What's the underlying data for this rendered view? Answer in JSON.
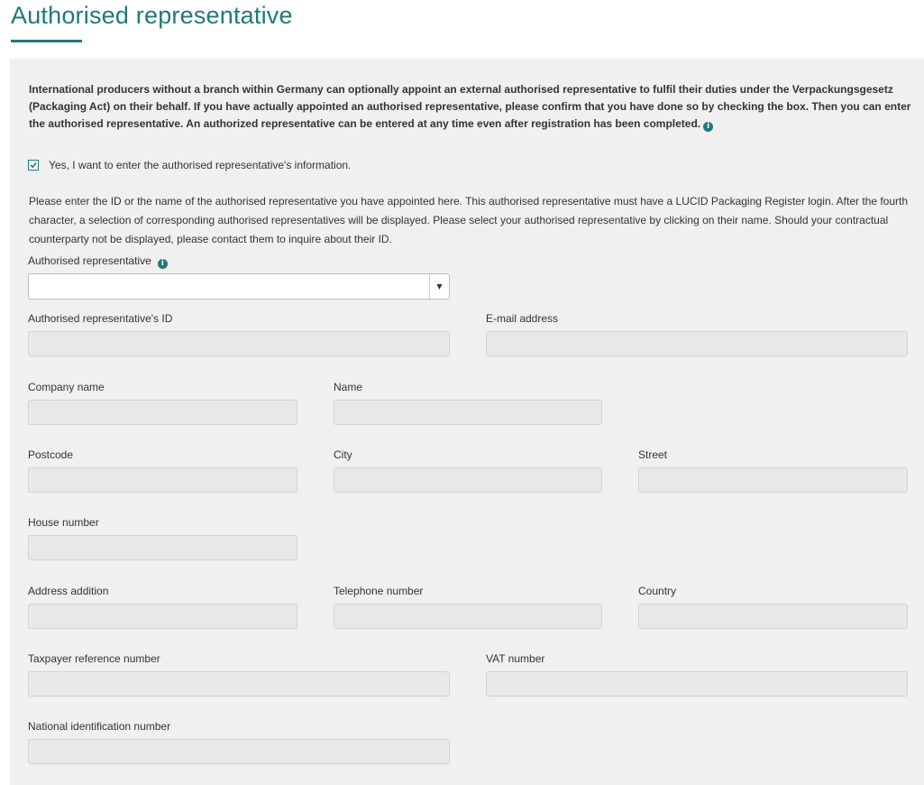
{
  "page": {
    "title": "Authorised representative"
  },
  "intro": {
    "text": "International producers without a branch within Germany can optionally appoint an external authorised representative to fulfil their duties under the Verpackungsgesetz (Packaging Act) on their behalf. If you have actually appointed an authorised representative, please confirm that you have done so by checking the box. Then you can enter the authorised representative. An authorized representative can be entered at any time even after registration has been completed.",
    "info_icon": "info-icon"
  },
  "checkbox": {
    "label": "Yes, I want to enter the authorised representative's information.",
    "checked": true
  },
  "instructions": {
    "text": "Please enter the ID or the name of the authorised representative you have appointed here. This authorised representative must have a LUCID Packaging Register login. After the fourth character, a selection of corresponding authorised representatives will be displayed. Please select your authorised representative by clicking on their name. Should your contractual counterparty not be displayed, please contact them to inquire about their ID."
  },
  "representative_select": {
    "label": "Authorised representative",
    "value": "",
    "arrow": "▼"
  },
  "fields": {
    "rep_id": {
      "label": "Authorised representative's ID",
      "value": ""
    },
    "email": {
      "label": "E-mail address",
      "value": ""
    },
    "company_name": {
      "label": "Company name",
      "value": ""
    },
    "name": {
      "label": "Name",
      "value": ""
    },
    "postcode": {
      "label": "Postcode",
      "value": ""
    },
    "city": {
      "label": "City",
      "value": ""
    },
    "street": {
      "label": "Street",
      "value": ""
    },
    "house_number": {
      "label": "House number",
      "value": ""
    },
    "address_addition": {
      "label": "Address addition",
      "value": ""
    },
    "telephone": {
      "label": "Telephone number",
      "value": ""
    },
    "country": {
      "label": "Country",
      "value": ""
    },
    "taxpayer_ref": {
      "label": "Taxpayer reference number",
      "value": ""
    },
    "vat_number": {
      "label": "VAT number",
      "value": ""
    },
    "national_id": {
      "label": "National identification number",
      "value": ""
    }
  },
  "colors": {
    "accent": "#1f7a78",
    "panel_bg": "#f0f0f0",
    "disabled_field_bg": "#e8e8e8"
  }
}
